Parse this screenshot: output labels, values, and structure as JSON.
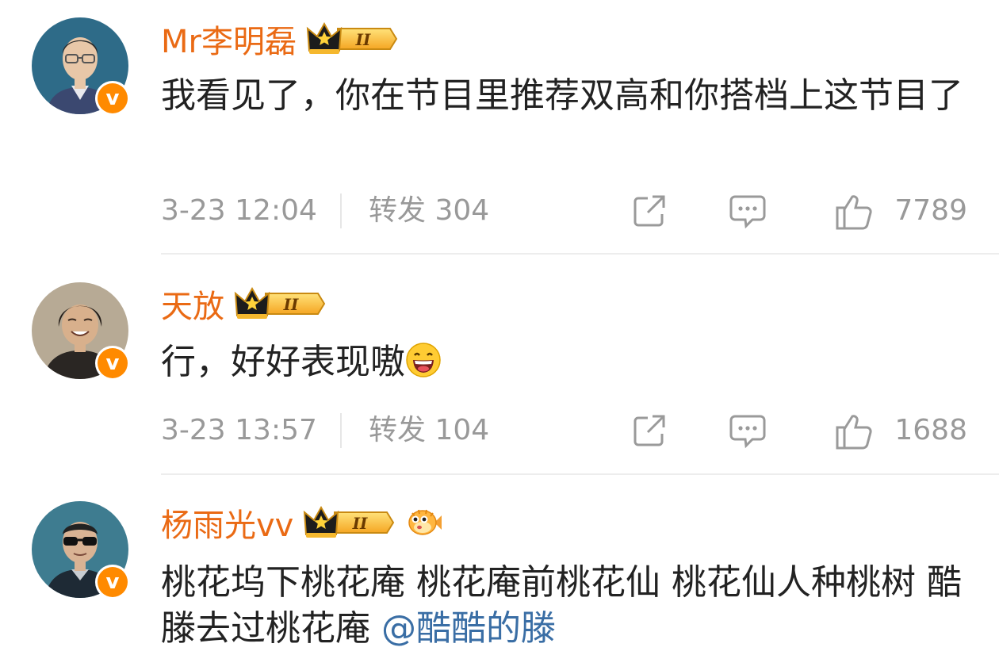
{
  "comments": [
    {
      "username": "Mr李明磊",
      "badge_level": "II",
      "text": "我看见了，你在节目里推荐双高和你搭档上这节目了",
      "time": "3-23 12:04",
      "repost": "转发 304",
      "likes": "7789",
      "avatar_colors": {
        "bg": "#2e6b88",
        "skin": "#e8c7a8",
        "shirt": "#3b4870"
      }
    },
    {
      "username": "天放",
      "badge_level": "II",
      "text": "行，好好表现嗷",
      "emoji": "laughing-face",
      "time": "3-23 13:57",
      "repost": "转发 104",
      "likes": "1688",
      "avatar_colors": {
        "bg": "#b7aa95",
        "skin": "#d8b08c",
        "shirt": "#2a2623"
      }
    },
    {
      "username": "杨雨光vv",
      "badge_level": "II",
      "extra_icon": "pufferfish-icon",
      "text_before_mention": "桃花坞下桃花庵  桃花庵前桃花仙 桃花仙人种桃树 酷滕去过桃花庵 ",
      "mention": "@酷酷的滕",
      "avatar_colors": {
        "bg": "#3e7c90",
        "skin": "#d9b394",
        "shirt": "#1e2a35"
      }
    }
  ],
  "colors": {
    "username": "#ea6a14",
    "text": "#222222",
    "meta": "#999999",
    "mention": "#3a6ea5",
    "verified": "#ff8a00"
  }
}
